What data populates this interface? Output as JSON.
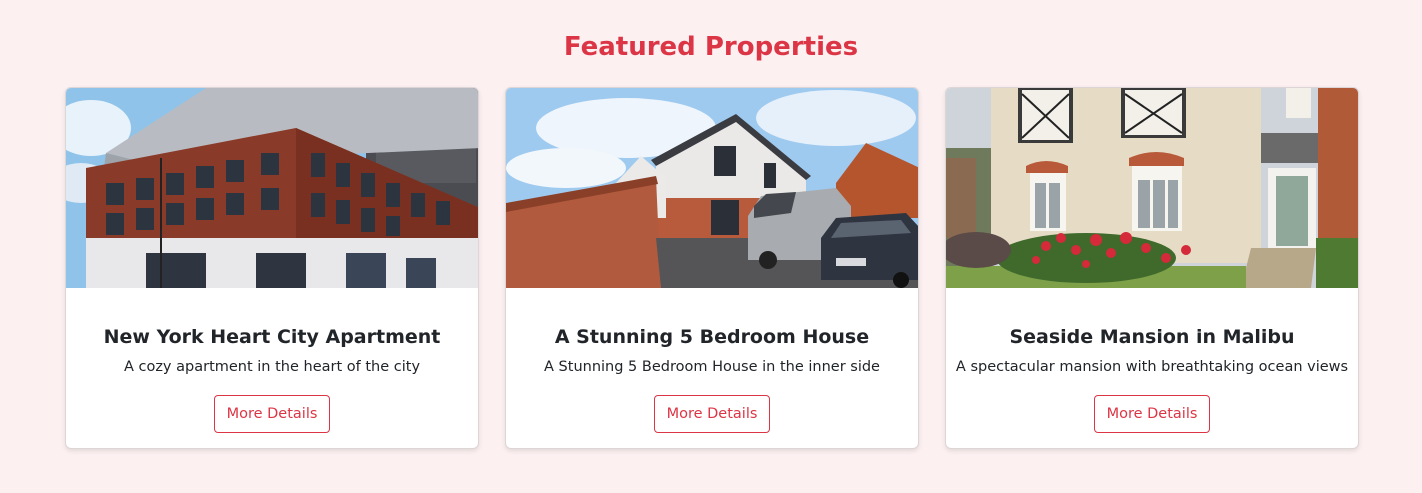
{
  "section": {
    "title": "Featured Properties"
  },
  "colors": {
    "accent": "#dc3545",
    "background": "#fcf0f1"
  },
  "properties": [
    {
      "title": "New York Heart City Apartment",
      "description": "A cozy apartment in the heart of the city",
      "button_label": "More Details",
      "image": "apartment-building-photo"
    },
    {
      "title": "A Stunning 5 Bedroom House",
      "description": "A Stunning 5 Bedroom House in the inner side",
      "button_label": "More Details",
      "image": "house-with-van-photo"
    },
    {
      "title": "Seaside Mansion in Malibu",
      "description": "A spectacular mansion with breathtaking ocean views",
      "button_label": "More Details",
      "image": "mansion-facade-photo"
    }
  ]
}
